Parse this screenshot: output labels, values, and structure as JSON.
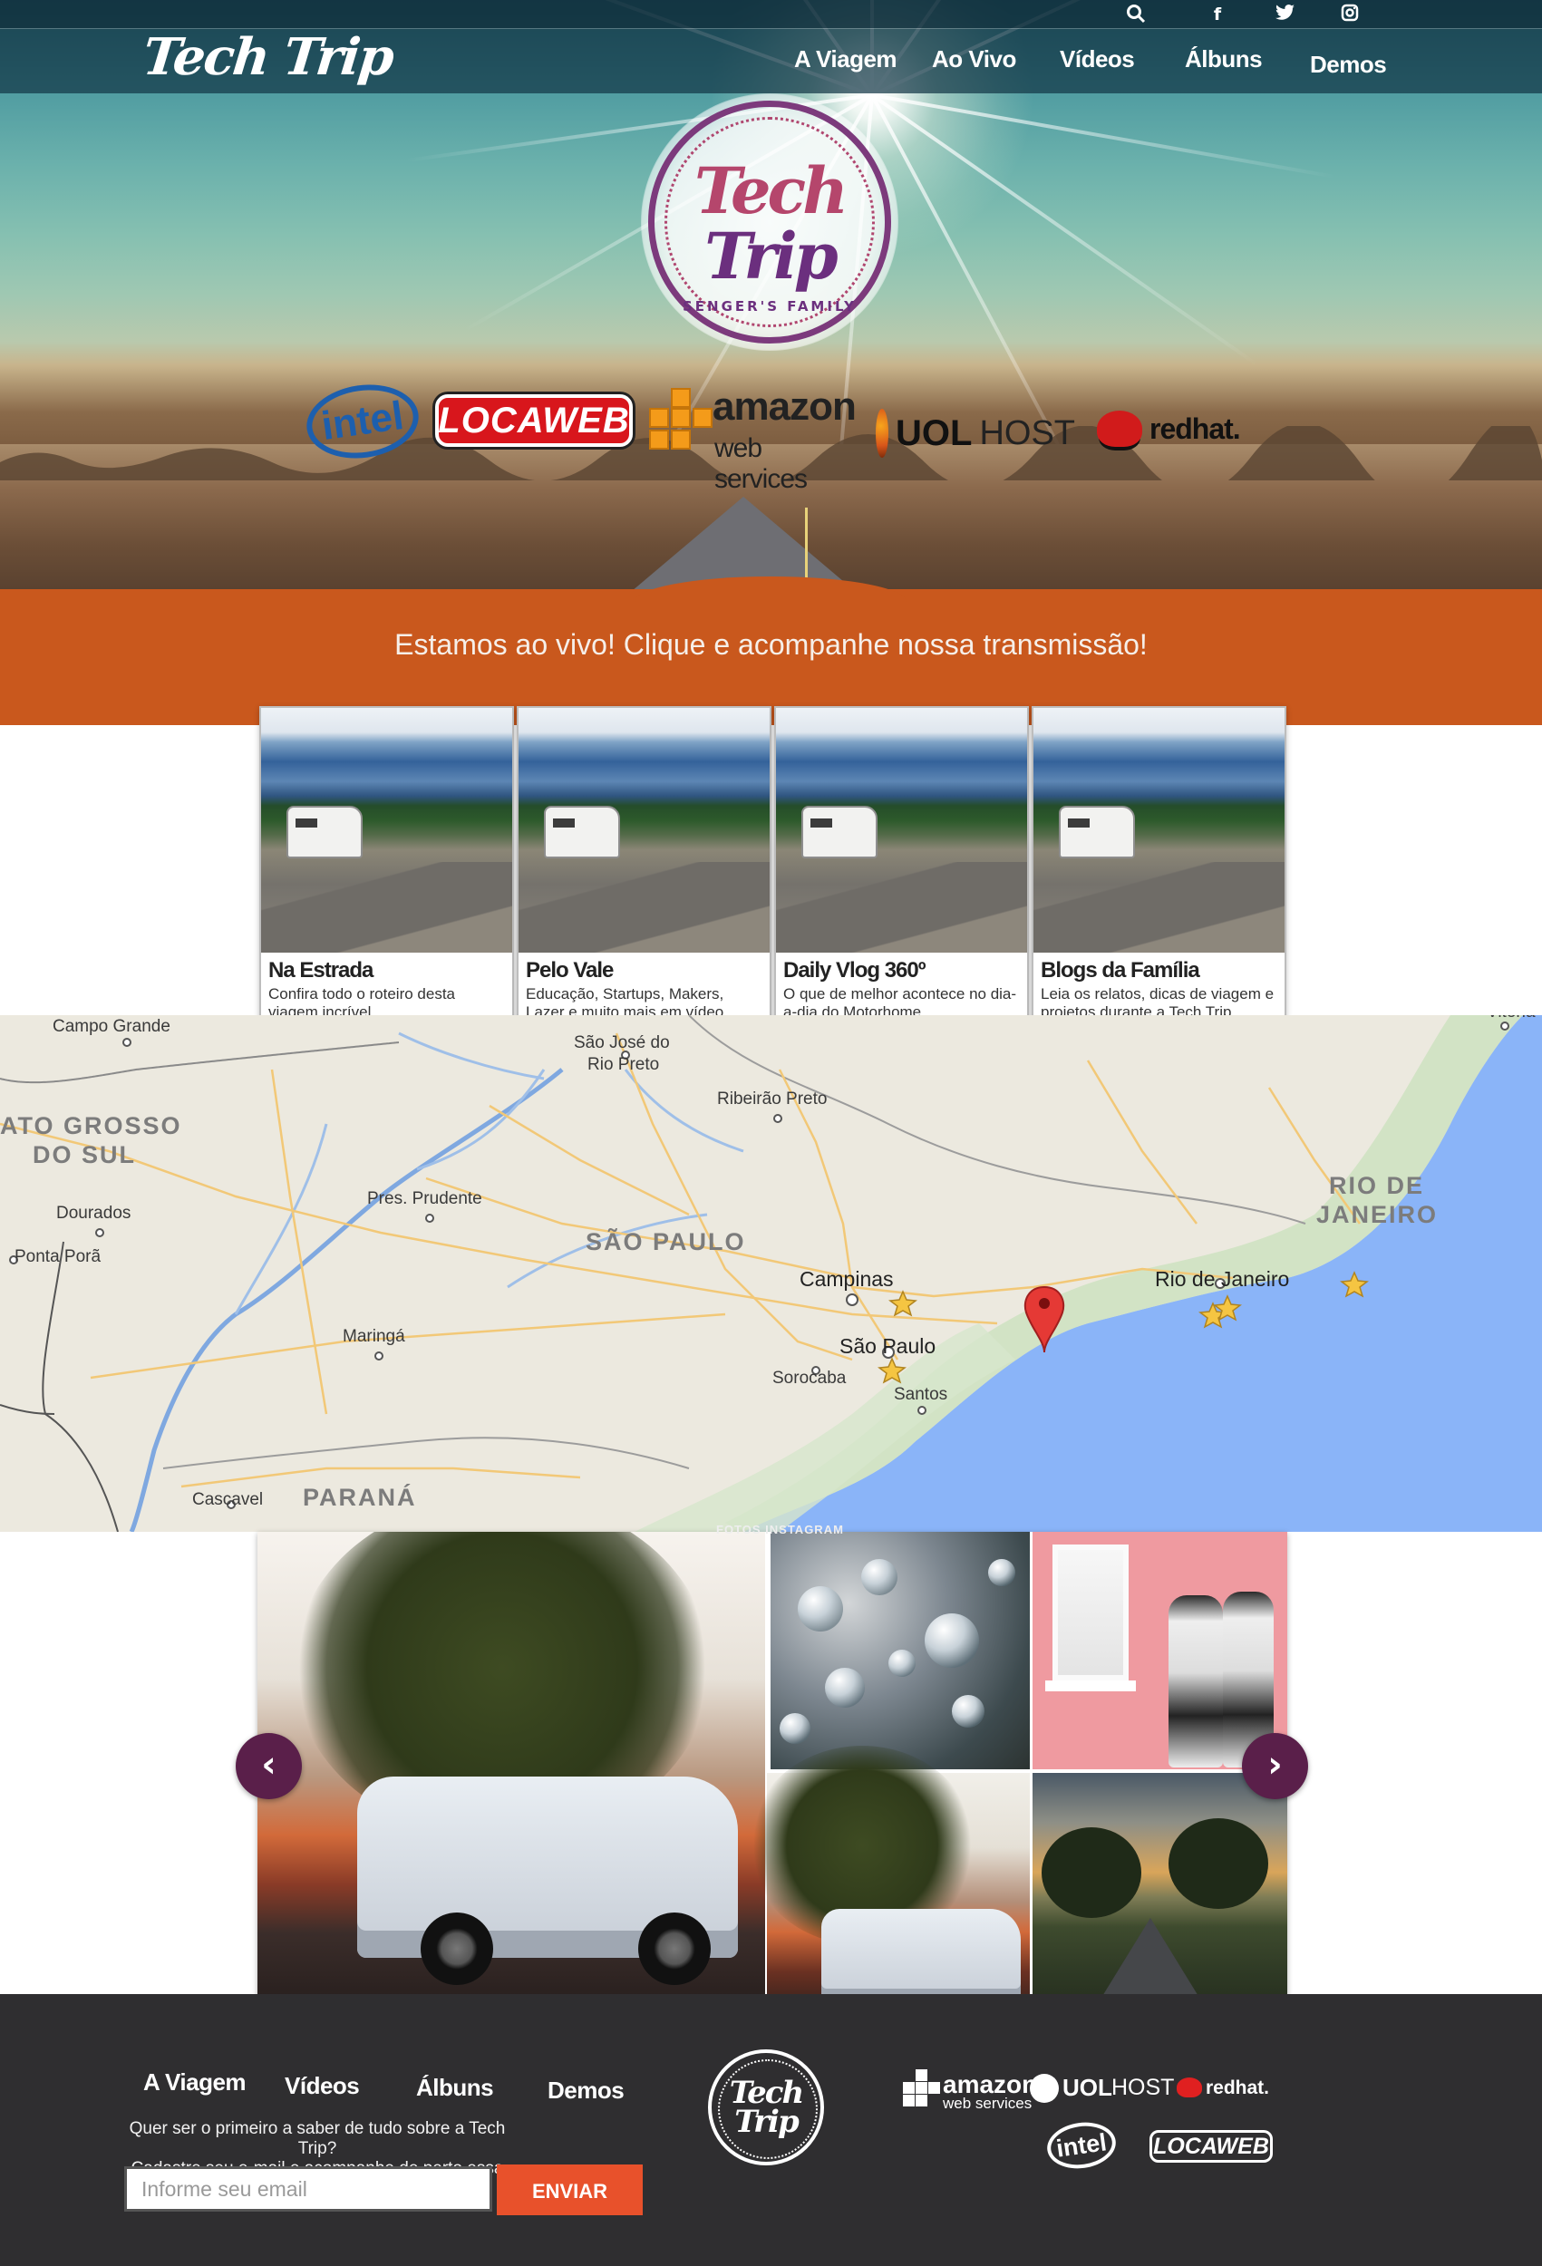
{
  "header": {
    "brand": "Tech Trip",
    "nav": [
      "A Viagem",
      "Ao Vivo",
      "Vídeos",
      "Álbuns",
      "Demos"
    ],
    "social_icons": [
      "search-icon",
      "facebook-icon",
      "twitter-icon",
      "instagram-icon"
    ]
  },
  "hero": {
    "seal_line1": "Tech",
    "seal_line2": "Trip",
    "seal_subtitle": "SENGER'S FAMILY",
    "sponsors": {
      "intel": "intel",
      "locaweb": "LOCAWEB",
      "aws_line1": "amazon",
      "aws_line2": "web services",
      "uol": "UOL",
      "uol_host": "HOST",
      "redhat": "redhat."
    }
  },
  "live_banner": {
    "text": "Estamos ao vivo! Clique e acompanhe nossa transmissão!"
  },
  "cards": [
    {
      "title": "Na Estrada",
      "desc": "Confira todo o roteiro desta viagem incrível"
    },
    {
      "title": "Pelo Vale",
      "desc": "Educação, Startups, Makers, Lazer e muito mais em vídeo"
    },
    {
      "title": "Daily Vlog 360º",
      "desc": "O que de melhor acontece no dia-a-dia do Motorhome"
    },
    {
      "title": "Blogs da Família",
      "desc": "Leia os relatos, dicas de viagem e projetos durante a Tech Trip"
    }
  ],
  "map": {
    "states": [
      "ATO GROSSO",
      "DO SUL",
      "SÃO PAULO",
      "RIO DE",
      "JANEIRO",
      "PARANÁ"
    ],
    "cities": [
      "Campo Grande",
      "São José do",
      "Rio Preto",
      "Ribeirão Preto",
      "Dourados",
      "Pres. Prudente",
      "Ponta Porã",
      "Campinas",
      "Rio de Janeiro",
      "São Paulo",
      "Sorocaba",
      "Santos",
      "Maringá",
      "Cascavel",
      "Vitória"
    ]
  },
  "gallery": {
    "label": "FOTOS INSTAGRAM",
    "prev": "‹",
    "next": "›"
  },
  "footer": {
    "nav": [
      "A Viagem",
      "Vídeos",
      "Álbuns",
      "Demos"
    ],
    "signup_line1": "Quer ser o primeiro a saber de tudo sobre a Tech Trip?",
    "signup_line2": "Cadastre seu e-mail e acompanhe de perto essa viagem",
    "email_placeholder": "Informe seu email",
    "send_label": "ENVIAR",
    "seal_line1": "Tech",
    "seal_line2": "Trip",
    "sponsors": {
      "aws_line1": "amazon",
      "aws_line2": "web services",
      "uol": "UOL",
      "uol_host": "HOST",
      "redhat": "redhat.",
      "intel": "intel",
      "locaweb": "LOCAWEB"
    }
  },
  "colors": {
    "live_orange": "#c9581d",
    "footer_bg": "#2f2e30",
    "arrow_purple": "#5a1f4a",
    "send_button": "#e8512b"
  }
}
